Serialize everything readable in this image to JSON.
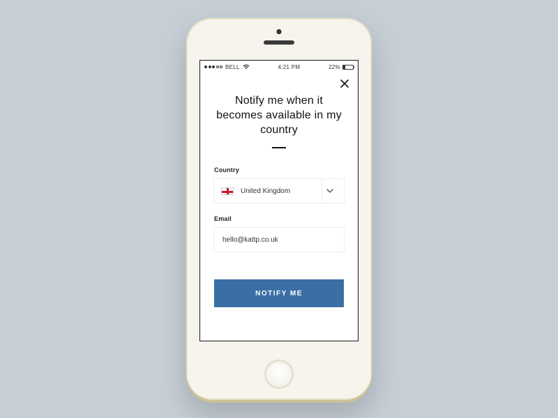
{
  "statusbar": {
    "carrier": "BELL",
    "time": "4:21 PM",
    "battery_pct": "22%"
  },
  "app": {
    "title": "Notify me when it becomes available in my country",
    "country_label": "Country",
    "country_value": "United Kingdom",
    "email_label": "Email",
    "email_value": "hello@kattp.co.uk",
    "cta_label": "NOTIFY ME"
  }
}
